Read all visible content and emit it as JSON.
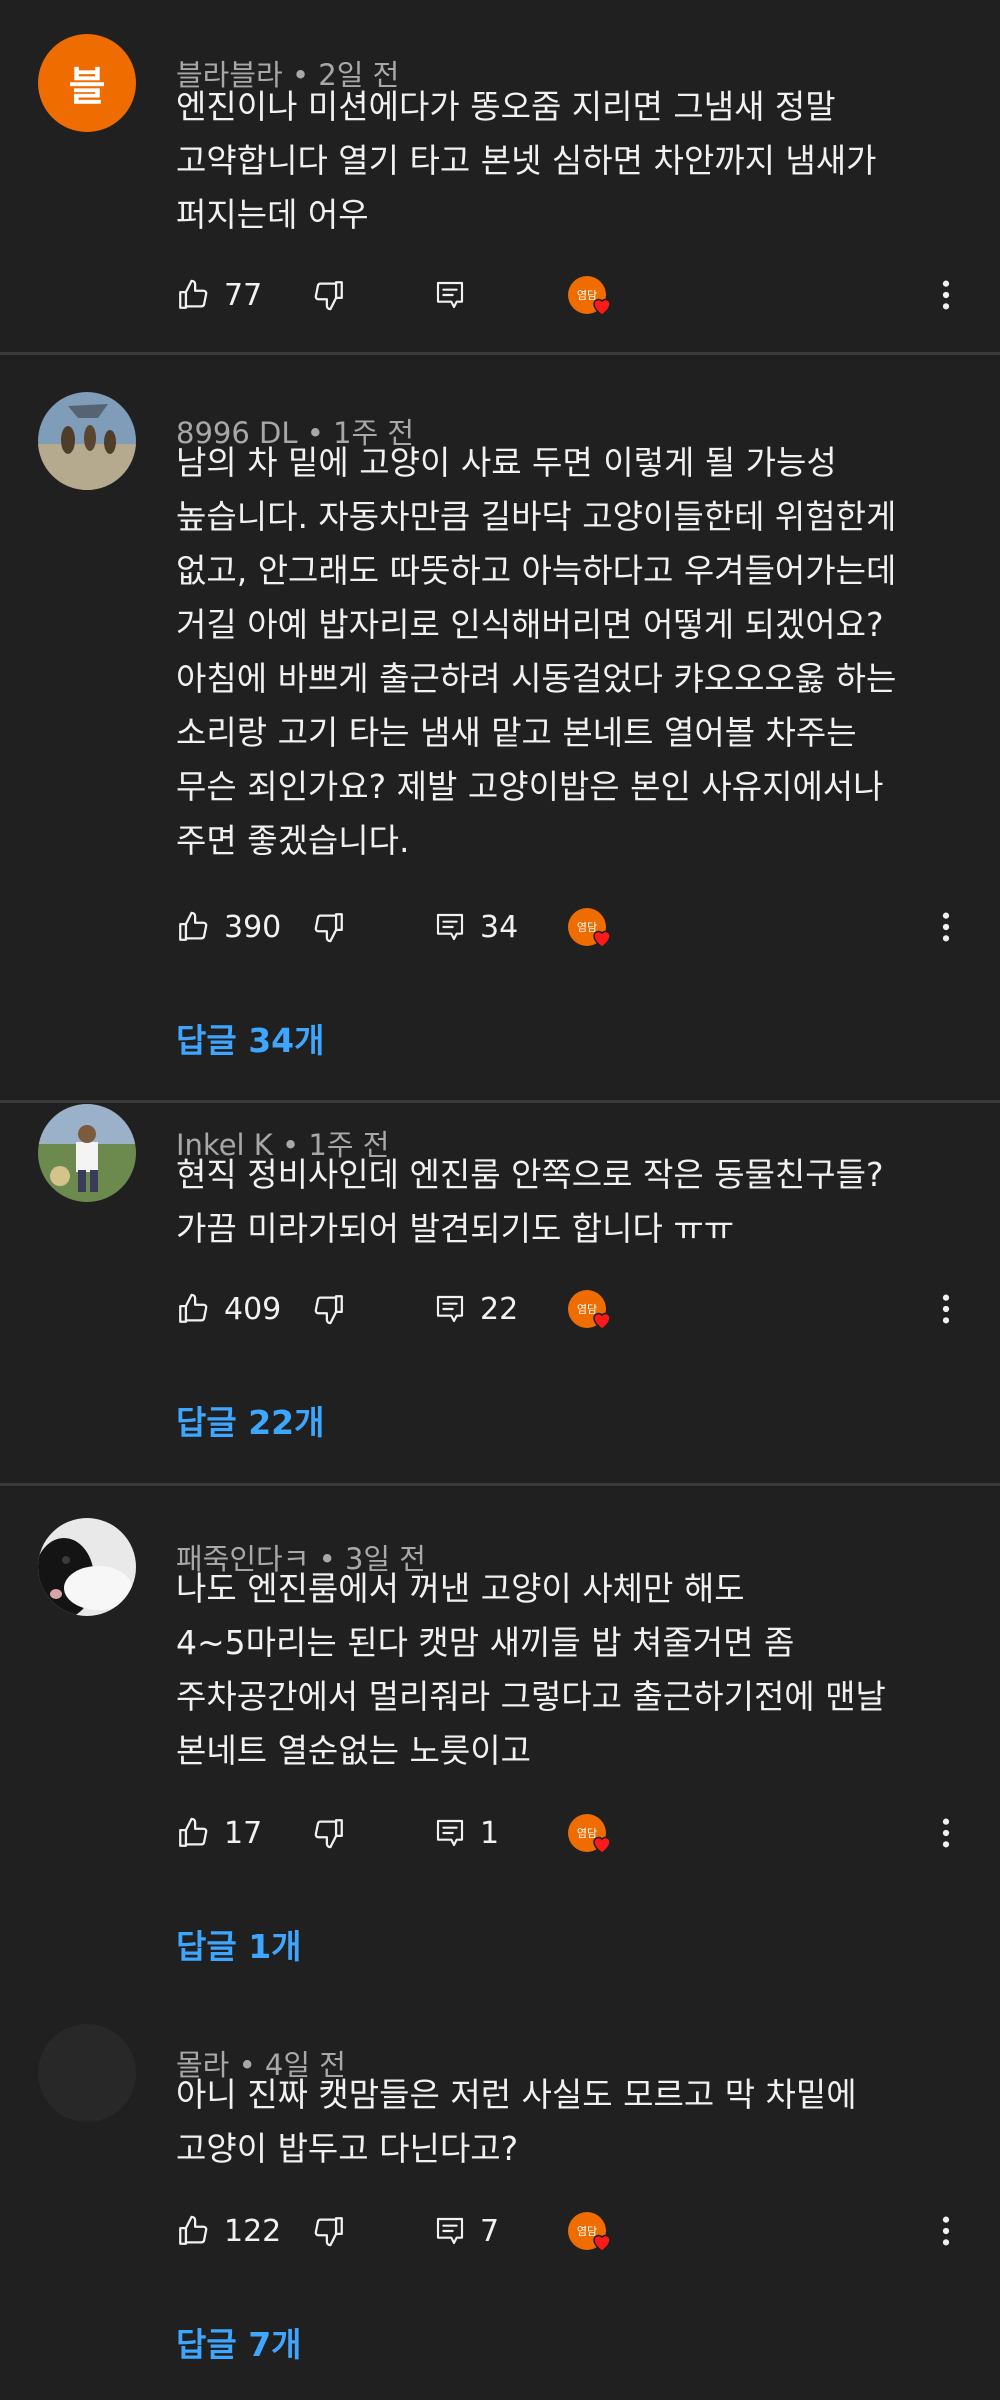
{
  "comments": [
    {
      "author": "블라블라",
      "time": "2일 전",
      "avatar_letter": "블",
      "avatar_color": "#ef6c00",
      "text_lines": [
        "엔진이나 미션에다가 똥오줌 지리면 그냄새 정말",
        "고약합니다 열기 타고  본넷 심하면 차안까지 냄새가",
        "퍼지는데 어우"
      ],
      "likes": "77",
      "reply_count": "",
      "replies_label": ""
    },
    {
      "author": "8996 DL",
      "time": "1주 전",
      "text_lines": [
        "남의 차 밑에 고양이 사료 두면 이렇게 될 가능성",
        "높습니다. 자동차만큼 길바닥 고양이들한테 위험한게",
        "없고, 안그래도 따뜻하고 아늑하다고 우겨들어가는데",
        "거길 아예 밥자리로 인식해버리면 어떻게 되겠어요?",
        "아침에 바쁘게 출근하려 시동걸었다 캬오오오옳 하는",
        "소리랑 고기 타는 냄새 맡고 본네트 열어볼 차주는",
        "무슨 죄인가요? 제발 고양이밥은 본인 사유지에서나",
        "주면 좋겠습니다."
      ],
      "likes": "390",
      "reply_count": "34",
      "replies_label": "답글 34개"
    },
    {
      "author": "Inkel K",
      "time": "1주 전",
      "text_lines": [
        "현직 정비사인데  엔진룸 안쪽으로 작은 동물친구들?",
        "가끔 미라가되어 발견되기도 합니다 ㅠㅠ"
      ],
      "likes": "409",
      "reply_count": "22",
      "replies_label": "답글 22개"
    },
    {
      "author": "패죽인다ㅋ",
      "time": "3일 전",
      "text_lines": [
        "나도 엔진룸에서 꺼낸 고양이 사체만 해도",
        "4~5마리는 된다 캣맘 새끼들 밥 쳐줄거면 좀",
        "주차공간에서 멀리줘라  그렇다고 출근하기전에 맨날",
        "본네트 열순없는 노릇이고"
      ],
      "likes": "17",
      "reply_count": "1",
      "replies_label": "답글 1개"
    },
    {
      "author": "몰라",
      "time": "4일 전",
      "text_lines": [
        "아니 진짜 캣맘들은 저런 사실도 모르고 막 차밑에",
        "고양이 밥두고 다닌다고?"
      ],
      "likes": "122",
      "reply_count": "7",
      "replies_label": "답글 7개"
    }
  ],
  "creator_heart_label": "염담",
  "colors": {
    "background": "#202020",
    "text": "#f1f1f1",
    "meta": "#a8a8a8",
    "link": "#3ea6ff",
    "accent": "#ef6c00",
    "heart": "#ff1a1a"
  },
  "icons": {
    "like": "thumb-up-icon",
    "dislike": "thumb-down-icon",
    "reply": "reply-icon",
    "more": "more-vert-icon",
    "heart": "creator-heart-icon"
  }
}
